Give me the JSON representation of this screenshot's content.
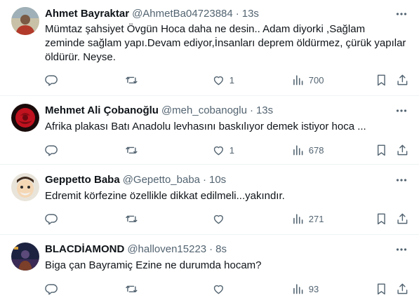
{
  "tweets": [
    {
      "name": "Ahmet Bayraktar",
      "handle": "@AhmetBa04723884",
      "dot": "·",
      "time": "13s",
      "text": "Mümtaz şahsiyet Övgün Hoca daha ne desin.. Adam diyorki ,Sağlam zeminde sağlam yapı.Devam ediyor,İnsanları deprem öldürmez, çürük yapılar öldürür. Neyse.",
      "replies": "",
      "retweets": "",
      "likes": "1",
      "views": "700"
    },
    {
      "name": "Mehmet Ali Çobanoğlu",
      "handle": "@meh_cobanoglu",
      "dot": "·",
      "time": "13s",
      "text": "Afrika plakası Batı Anadolu levhasını baskılıyor demek istiyor hoca ...",
      "replies": "",
      "retweets": "",
      "likes": "1",
      "views": "678"
    },
    {
      "name": "Geppetto Baba",
      "handle": "@Gepetto_baba",
      "dot": "·",
      "time": "10s",
      "text": "Edremit körfezine özellikle dikkat edilmeli...yakındır.",
      "replies": "",
      "retweets": "",
      "likes": "",
      "views": "271"
    },
    {
      "name": "BLACDİAMOND",
      "handle": "@halloven15223",
      "dot": "·",
      "time": "8s",
      "text": "Biga çan Bayramiç Ezine ne durumda hocam?",
      "replies": "",
      "retweets": "",
      "likes": "",
      "views": "93"
    }
  ],
  "icons": {
    "reply": "reply-icon",
    "retweet": "retweet-icon",
    "like": "heart-icon",
    "views": "views-chart-icon",
    "bookmark": "bookmark-icon",
    "share": "share-icon",
    "more": "more-dots-icon"
  },
  "colors": {
    "text": "#0f1419",
    "secondary": "#536471",
    "divider": "#eff3f4"
  }
}
